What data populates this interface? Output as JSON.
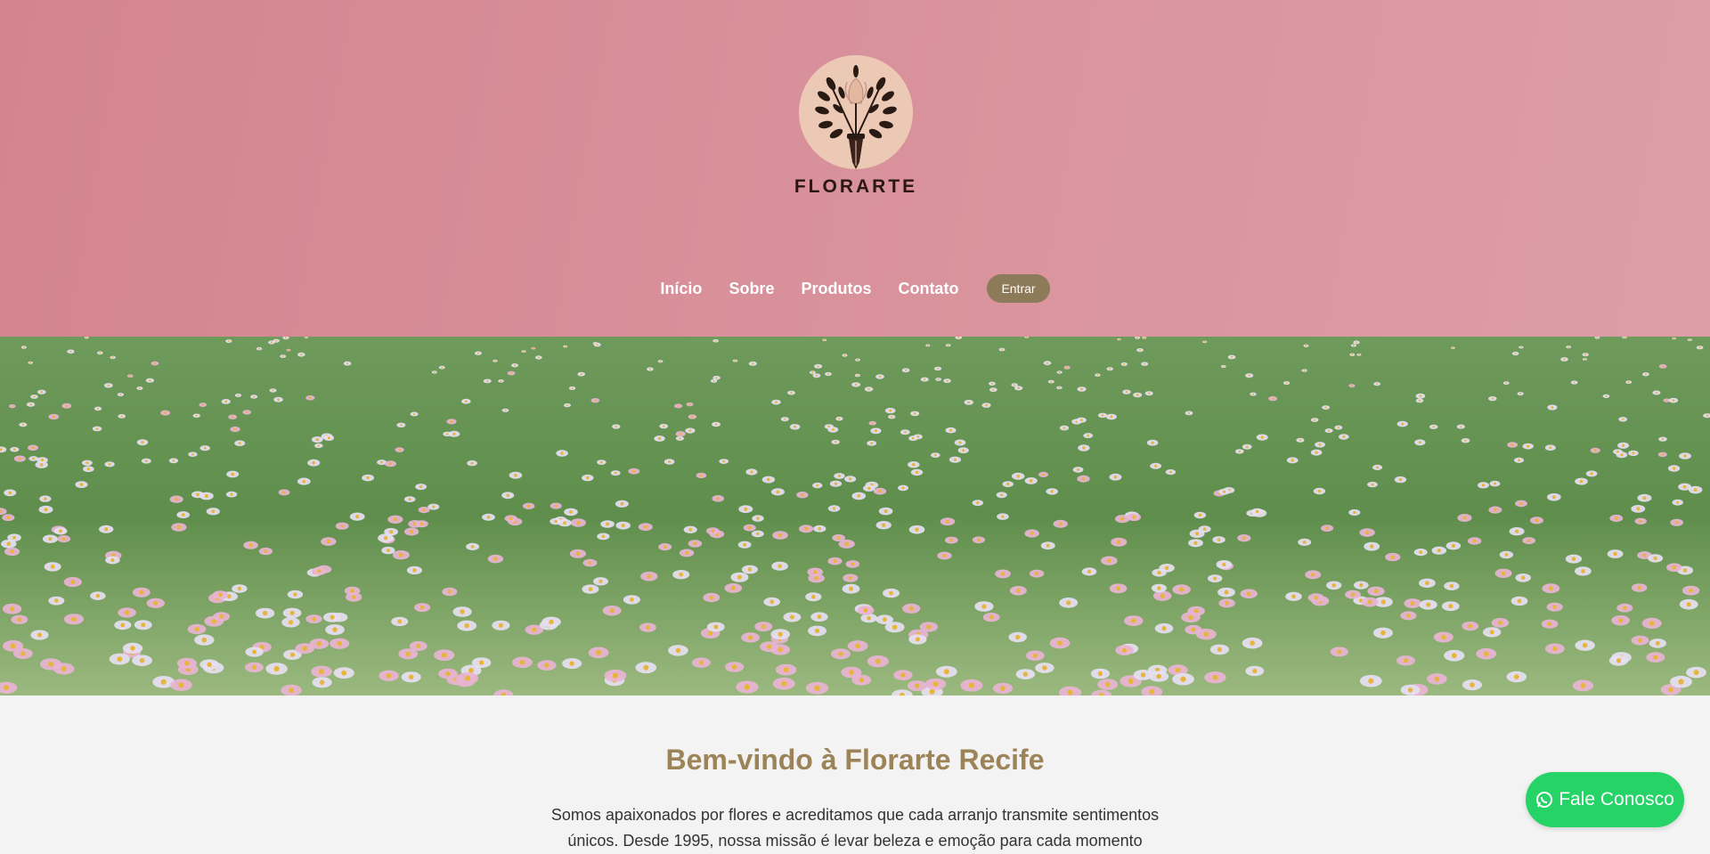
{
  "brand": {
    "name": "FLORARTE",
    "colors": {
      "header_pink": "#d88c96",
      "accent_gold": "#9c8458",
      "button_brown": "#8c7a58",
      "whatsapp_green": "#25d366"
    }
  },
  "nav": {
    "items": [
      {
        "label": "Início"
      },
      {
        "label": "Sobre"
      },
      {
        "label": "Produtos"
      },
      {
        "label": "Contato"
      }
    ],
    "login_label": "Entrar"
  },
  "hero": {
    "icon": "flower-field-banner"
  },
  "welcome": {
    "title": "Bem-vindo à Florarte Recife",
    "text": "Somos apaixonados por flores e acreditamos que cada arranjo transmite sentimentos únicos. Desde 1995, nossa missão é levar beleza e emoção para cada momento"
  },
  "whatsapp": {
    "label": "Fale Conosco",
    "icon": "whatsapp-icon"
  }
}
